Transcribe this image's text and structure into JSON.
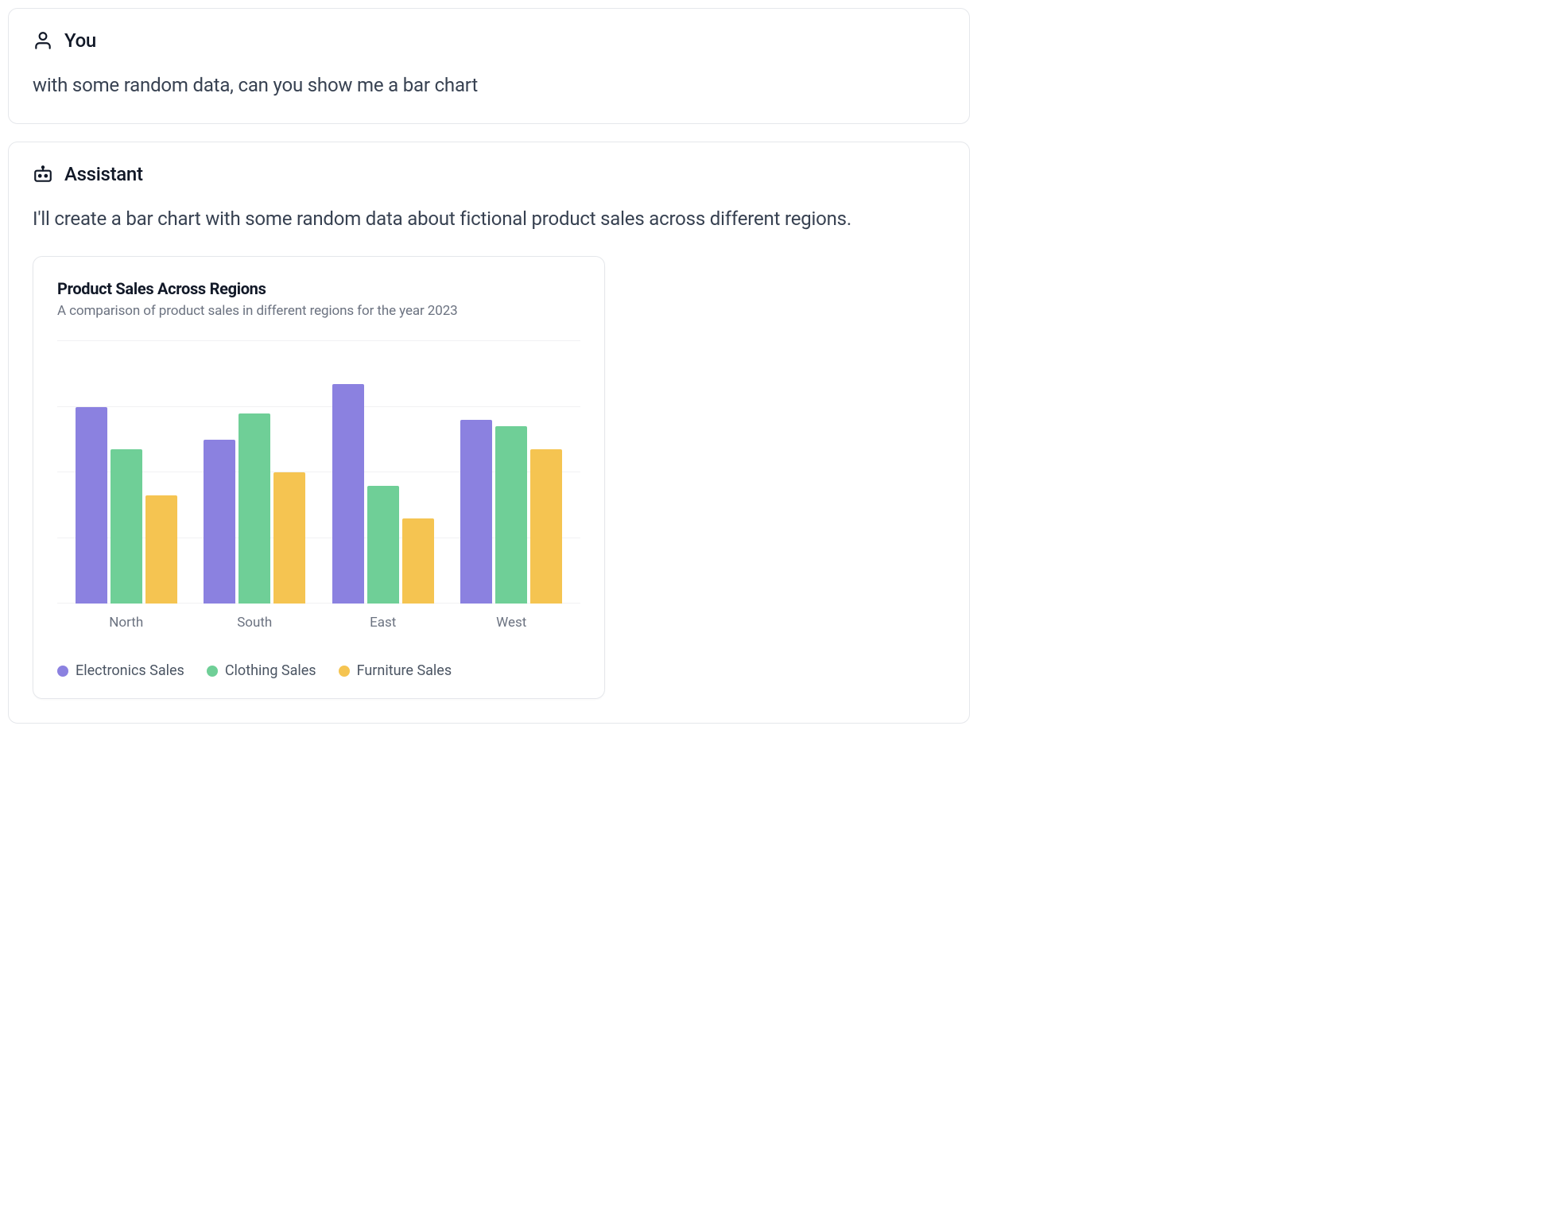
{
  "user_msg": {
    "sender": "You",
    "text": "with some random data, can you show me a bar chart"
  },
  "assistant_msg": {
    "sender": "Assistant",
    "text": "I'll create a bar chart with some random data about fictional product sales across different regions."
  },
  "chart_card": {
    "title": "Product Sales Across Regions",
    "subtitle": "A comparison of product sales in different regions for the year 2023"
  },
  "colors": {
    "electronics": "#8b81e0",
    "clothing": "#6fcf97",
    "furniture": "#f5c451"
  },
  "chart_data": {
    "type": "bar",
    "title": "Product Sales Across Regions",
    "subtitle": "A comparison of product sales in different regions for the year 2023",
    "xlabel": "",
    "ylabel": "",
    "ylim": [
      0,
      400
    ],
    "gridlines": [
      0,
      100,
      200,
      300,
      400
    ],
    "categories": [
      "North",
      "South",
      "East",
      "West"
    ],
    "series": [
      {
        "name": "Electronics Sales",
        "color": "#8b81e0",
        "values": [
          300,
          250,
          335,
          280
        ]
      },
      {
        "name": "Clothing Sales",
        "color": "#6fcf97",
        "values": [
          235,
          290,
          180,
          270
        ]
      },
      {
        "name": "Furniture Sales",
        "color": "#f5c451",
        "values": [
          165,
          200,
          130,
          235
        ]
      }
    ],
    "legend_position": "bottom"
  }
}
